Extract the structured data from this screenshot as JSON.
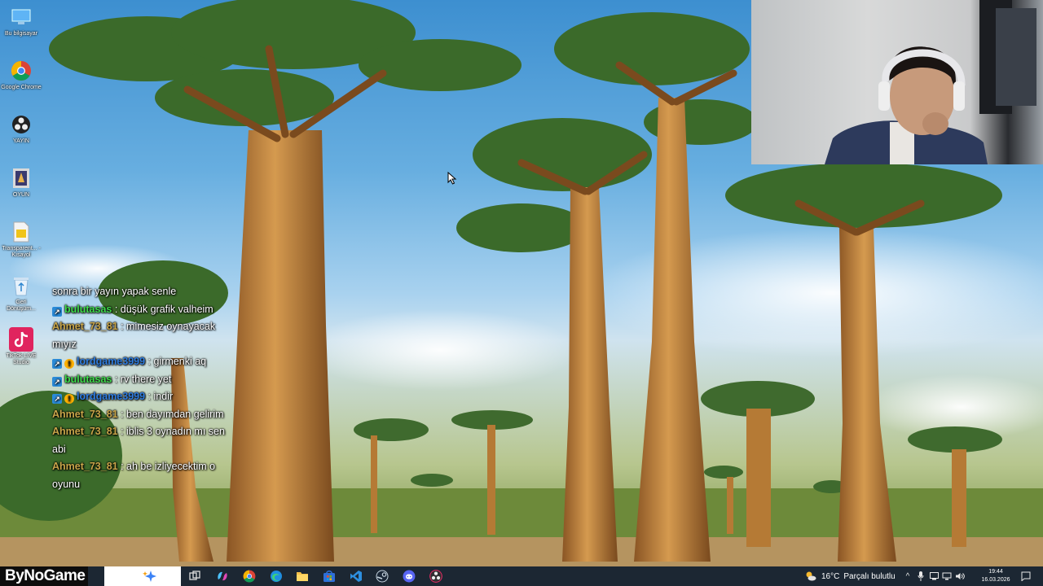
{
  "desktop_icons": [
    {
      "label": "Bu bilgisayar",
      "icon": "computer-icon"
    },
    {
      "label": "Google Chrome",
      "icon": "chrome-icon"
    },
    {
      "label": "YAYIN",
      "icon": "obs-icon"
    },
    {
      "label": "OYUN",
      "icon": "game-icon"
    },
    {
      "label": "Transparent... - Kısayol",
      "icon": "file-icon"
    },
    {
      "label": "Geri Dönüşüm...",
      "icon": "recycle-bin-icon"
    },
    {
      "label": "TikTok LIVE Studio",
      "icon": "tiktok-icon"
    }
  ],
  "chat": {
    "messages": [
      {
        "user": "",
        "text": "sonra bir yayın yapak senle",
        "user_color": "#ffffff",
        "badges": []
      },
      {
        "user": "bulutasas",
        "text": " : düşük grafik valheim",
        "user_color": "#3ddc4a",
        "badges": [
          "twitch"
        ]
      },
      {
        "user": "Ahmet_73_81",
        "text": " : mimesiz oynayacak mıyız",
        "user_color": "#c9a64a",
        "badges": []
      },
      {
        "user": "lordgame3999",
        "text": " : girmenki aq",
        "user_color": "#2f7de0",
        "badges": [
          "twitch",
          "warn"
        ]
      },
      {
        "user": "bulutasas",
        "text": " : rv there yet",
        "user_color": "#3ddc4a",
        "badges": [
          "twitch"
        ]
      },
      {
        "user": "lordgame3999",
        "text": " : indir",
        "user_color": "#2f7de0",
        "badges": [
          "twitch",
          "warn"
        ]
      },
      {
        "user": "Ahmet_73_81",
        "text": " : ben dayımdan gelirim",
        "user_color": "#c9a64a",
        "badges": []
      },
      {
        "user": "Ahmet_73_81",
        "text": " : iblis 3 oynadın mı sen abi",
        "user_color": "#c9a64a",
        "badges": []
      },
      {
        "user": "Ahmet_73_81",
        "text": " : ah be izliyecektim o oyunu",
        "user_color": "#c9a64a",
        "badges": []
      }
    ]
  },
  "taskbar": {
    "brand": "ByNoGame",
    "apps": [
      "task-view-icon",
      "copilot-icon",
      "chrome-icon",
      "edge-icon",
      "file-explorer-icon",
      "store-icon",
      "vscode-icon",
      "steam-icon",
      "discord-icon",
      "obs-icon"
    ],
    "weather": {
      "temp": "16°C",
      "condition": "Parçalı bulutlu"
    },
    "time": "19:44",
    "date": "16.03.2026"
  },
  "colors": {
    "taskbar_bg": "#1c2733",
    "sky_top": "#3d8fd0",
    "baobab_trunk": "#c98a3e",
    "canopy": "#3f6a2e"
  }
}
